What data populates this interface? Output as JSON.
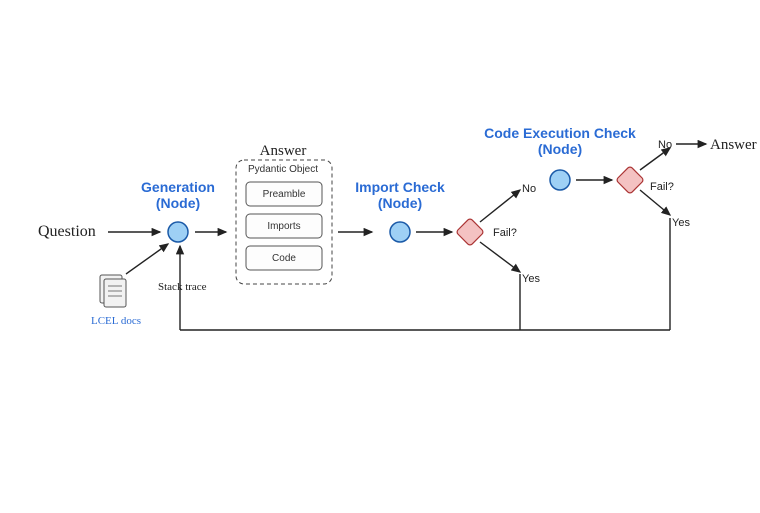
{
  "input": {
    "label": "Question"
  },
  "docs": {
    "label": "LCEL docs"
  },
  "stack_trace": {
    "label": "Stack trace"
  },
  "generation": {
    "title": "Generation",
    "subtitle": "(Node)"
  },
  "answer_box": {
    "title": "Answer",
    "subtitle": "Pydantic Object",
    "fields": [
      "Preamble",
      "Imports",
      "Code"
    ]
  },
  "import_check": {
    "title": "Import Check",
    "subtitle": "(Node)"
  },
  "import_decision": {
    "label": "Fail?",
    "no": "No",
    "yes": "Yes"
  },
  "exec_check": {
    "title": "Code Execution Check",
    "subtitle": "(Node)"
  },
  "exec_decision": {
    "label": "Fail?",
    "no": "No",
    "yes": "Yes"
  },
  "output": {
    "label": "Answer"
  }
}
